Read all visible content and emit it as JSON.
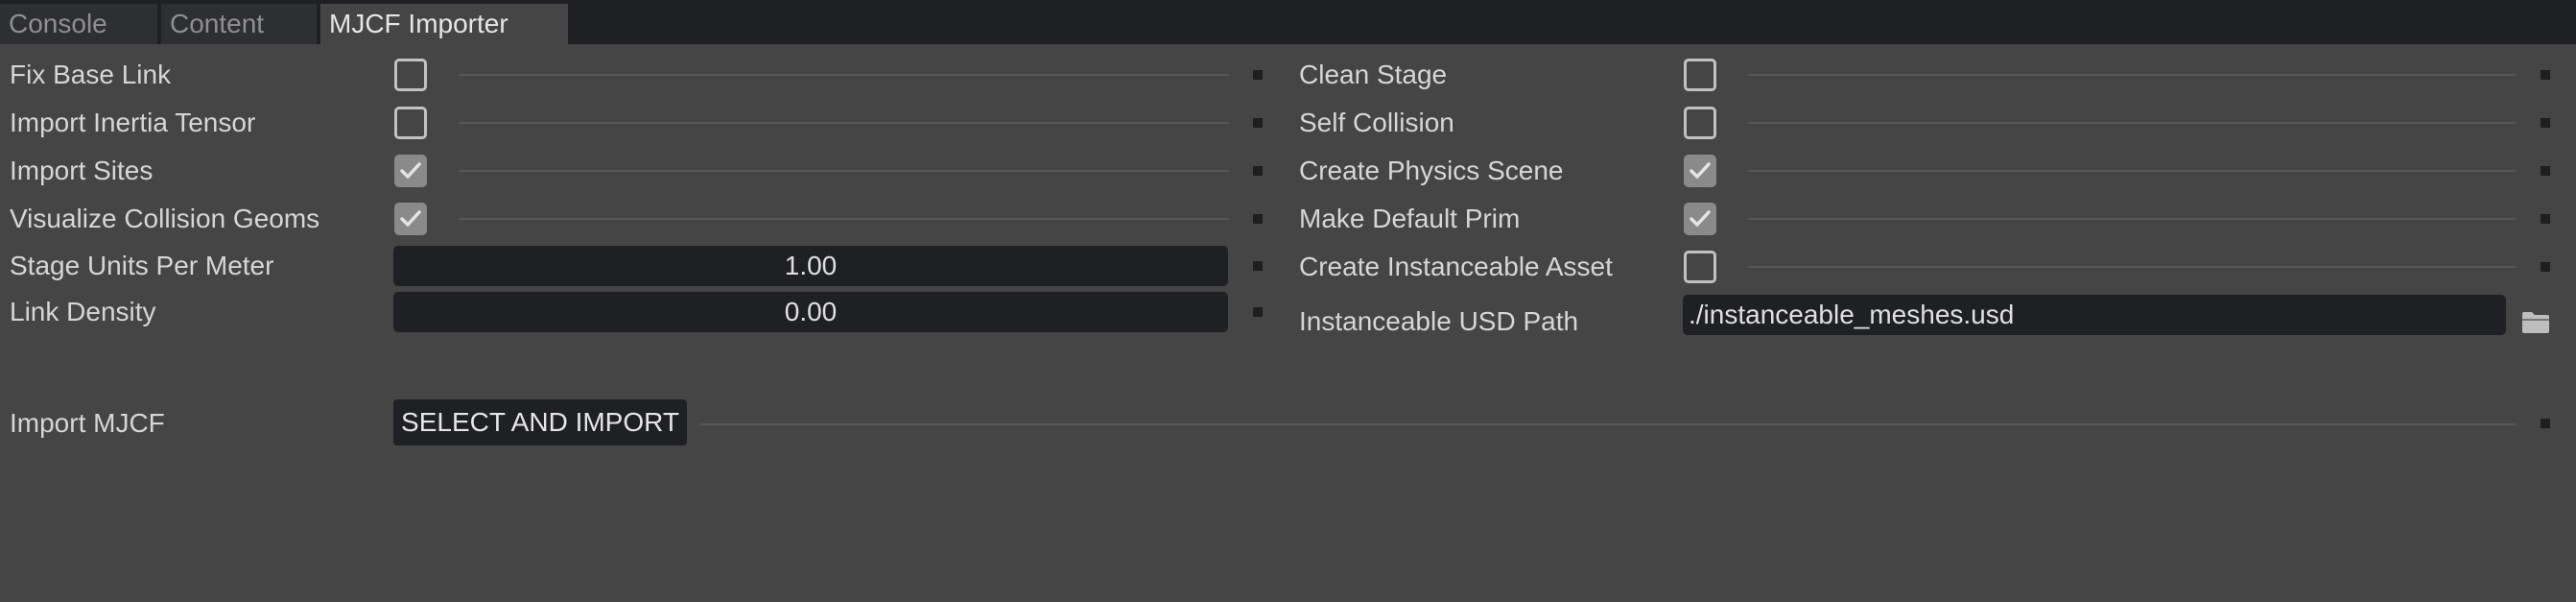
{
  "tabs": [
    "Console",
    "Content",
    "MJCF Importer"
  ],
  "active_tab": "MJCF Importer",
  "left_options": {
    "fix_base_link": {
      "label": "Fix Base Link",
      "checked": false
    },
    "import_inertia_tensor": {
      "label": "Import Inertia Tensor",
      "checked": false
    },
    "import_sites": {
      "label": "Import Sites",
      "checked": true
    },
    "visualize_collision_geoms": {
      "label": "Visualize Collision Geoms",
      "checked": true
    },
    "stage_units_per_meter": {
      "label": "Stage Units Per Meter",
      "value": "1.00"
    },
    "link_density": {
      "label": "Link Density",
      "value": "0.00"
    }
  },
  "right_options": {
    "clean_stage": {
      "label": "Clean Stage",
      "checked": false
    },
    "self_collision": {
      "label": "Self Collision",
      "checked": false
    },
    "create_physics_scene": {
      "label": "Create Physics Scene",
      "checked": true
    },
    "make_default_prim": {
      "label": "Make Default Prim",
      "checked": true
    },
    "create_instanceable_asset": {
      "label": "Create Instanceable Asset",
      "checked": false
    },
    "instanceable_usd_path": {
      "label": "Instanceable USD Path",
      "value": "./instanceable_meshes.usd"
    }
  },
  "import": {
    "label": "Import MJCF",
    "button_label": "SELECT AND IMPORT"
  },
  "icons": {
    "checkmark": "check-icon",
    "folder": "folder-icon"
  },
  "colors": {
    "panel_bg": "#454545",
    "tabbar_bg": "#1f2023",
    "field_bg": "#1f2023",
    "checkbox_checked_bg": "#8a8a8a"
  }
}
